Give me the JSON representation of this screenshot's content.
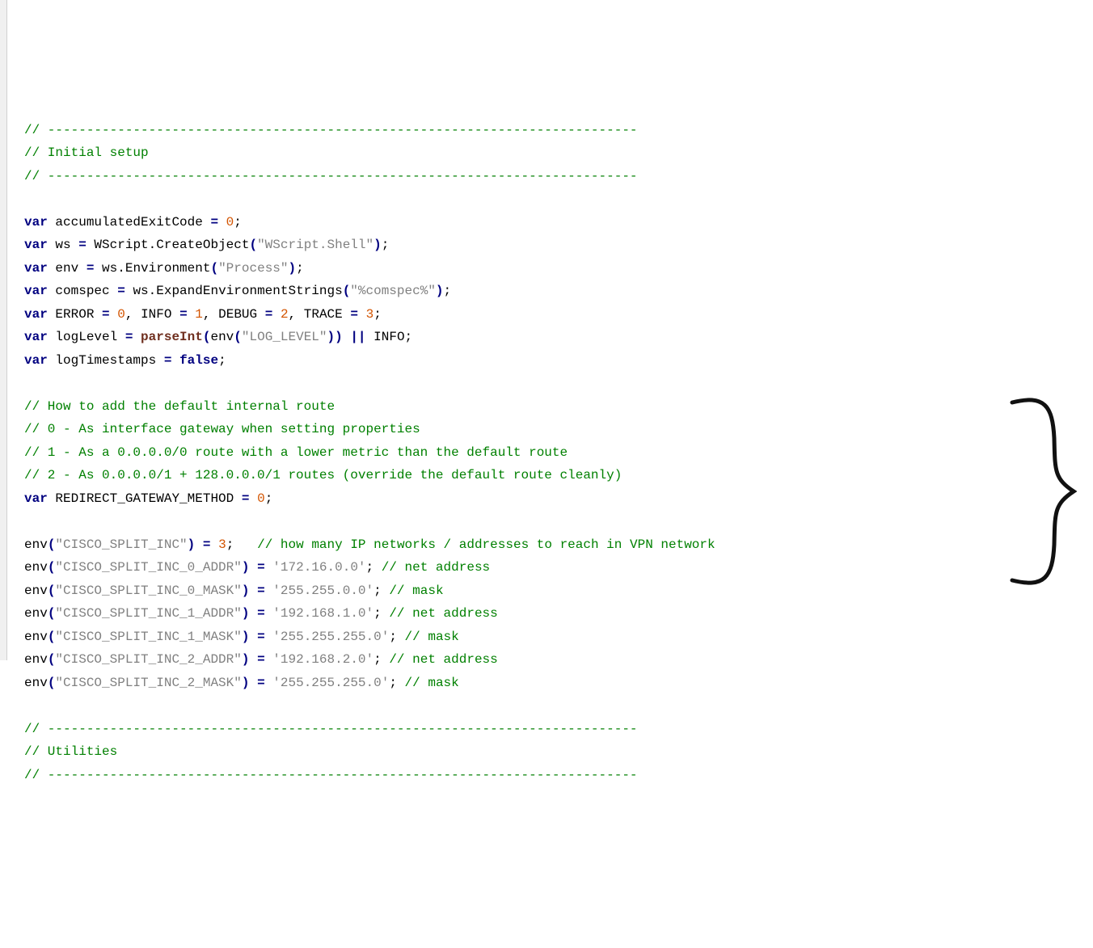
{
  "lines": [
    [
      [
        "c",
        "// ----------------------------------------------------------------------------"
      ]
    ],
    [
      [
        "c",
        "// Initial setup"
      ]
    ],
    [
      [
        "c",
        "// ----------------------------------------------------------------------------"
      ]
    ],
    [
      [
        "id",
        ""
      ]
    ],
    [
      [
        "kw",
        "var"
      ],
      [
        "id",
        " accumulatedExitCode "
      ],
      [
        "op",
        "="
      ],
      [
        "id",
        " "
      ],
      [
        "num",
        "0"
      ],
      [
        "id",
        ";"
      ]
    ],
    [
      [
        "kw",
        "var"
      ],
      [
        "id",
        " ws "
      ],
      [
        "op",
        "="
      ],
      [
        "id",
        " WScript.CreateObject"
      ],
      [
        "p",
        "("
      ],
      [
        "str",
        "\"WScript.Shell\""
      ],
      [
        "p",
        ")"
      ],
      [
        "id",
        ";"
      ]
    ],
    [
      [
        "kw",
        "var"
      ],
      [
        "id",
        " env "
      ],
      [
        "op",
        "="
      ],
      [
        "id",
        " ws.Environment"
      ],
      [
        "p",
        "("
      ],
      [
        "str",
        "\"Process\""
      ],
      [
        "p",
        ")"
      ],
      [
        "id",
        ";"
      ]
    ],
    [
      [
        "kw",
        "var"
      ],
      [
        "id",
        " comspec "
      ],
      [
        "op",
        "="
      ],
      [
        "id",
        " ws.ExpandEnvironmentStrings"
      ],
      [
        "p",
        "("
      ],
      [
        "str",
        "\"%comspec%\""
      ],
      [
        "p",
        ")"
      ],
      [
        "id",
        ";"
      ]
    ],
    [
      [
        "kw",
        "var"
      ],
      [
        "id",
        " ERROR "
      ],
      [
        "op",
        "="
      ],
      [
        "id",
        " "
      ],
      [
        "num",
        "0"
      ],
      [
        "id",
        ", INFO "
      ],
      [
        "op",
        "="
      ],
      [
        "id",
        " "
      ],
      [
        "num",
        "1"
      ],
      [
        "id",
        ", DEBUG "
      ],
      [
        "op",
        "="
      ],
      [
        "id",
        " "
      ],
      [
        "num",
        "2"
      ],
      [
        "id",
        ", TRACE "
      ],
      [
        "op",
        "="
      ],
      [
        "id",
        " "
      ],
      [
        "num",
        "3"
      ],
      [
        "id",
        ";"
      ]
    ],
    [
      [
        "kw",
        "var"
      ],
      [
        "id",
        " logLevel "
      ],
      [
        "op",
        "="
      ],
      [
        "id",
        " "
      ],
      [
        "fn",
        "parseInt"
      ],
      [
        "p",
        "("
      ],
      [
        "id",
        "env"
      ],
      [
        "p",
        "("
      ],
      [
        "str",
        "\"LOG_LEVEL\""
      ],
      [
        "p",
        "))"
      ],
      [
        "id",
        " "
      ],
      [
        "op",
        "||"
      ],
      [
        "id",
        " INFO;"
      ]
    ],
    [
      [
        "kw",
        "var"
      ],
      [
        "id",
        " logTimestamps "
      ],
      [
        "op",
        "="
      ],
      [
        "id",
        " "
      ],
      [
        "kw",
        "false"
      ],
      [
        "id",
        ";"
      ]
    ],
    [
      [
        "id",
        ""
      ]
    ],
    [
      [
        "c",
        "// How to add the default internal route"
      ]
    ],
    [
      [
        "c",
        "// 0 - As interface gateway when setting properties"
      ]
    ],
    [
      [
        "c",
        "// 1 - As a 0.0.0.0/0 route with a lower metric than the default route"
      ]
    ],
    [
      [
        "c",
        "// 2 - As 0.0.0.0/1 + 128.0.0.0/1 routes (override the default route cleanly)"
      ]
    ],
    [
      [
        "kw",
        "var"
      ],
      [
        "id",
        " REDIRECT_GATEWAY_METHOD "
      ],
      [
        "op",
        "="
      ],
      [
        "id",
        " "
      ],
      [
        "num",
        "0"
      ],
      [
        "id",
        ";"
      ]
    ],
    [
      [
        "id",
        ""
      ]
    ],
    [
      [
        "id",
        "env"
      ],
      [
        "p",
        "("
      ],
      [
        "str",
        "\"CISCO_SPLIT_INC\""
      ],
      [
        "p",
        ")"
      ],
      [
        "id",
        " "
      ],
      [
        "op",
        "="
      ],
      [
        "id",
        " "
      ],
      [
        "num",
        "3"
      ],
      [
        "id",
        ";   "
      ],
      [
        "c",
        "// how many IP networks / addresses to reach in VPN network"
      ]
    ],
    [
      [
        "id",
        "env"
      ],
      [
        "p",
        "("
      ],
      [
        "str",
        "\"CISCO_SPLIT_INC_0_ADDR\""
      ],
      [
        "p",
        ")"
      ],
      [
        "id",
        " "
      ],
      [
        "op",
        "="
      ],
      [
        "id",
        " "
      ],
      [
        "str",
        "'172.16.0.0'"
      ],
      [
        "id",
        "; "
      ],
      [
        "c",
        "// net address"
      ]
    ],
    [
      [
        "id",
        "env"
      ],
      [
        "p",
        "("
      ],
      [
        "str",
        "\"CISCO_SPLIT_INC_0_MASK\""
      ],
      [
        "p",
        ")"
      ],
      [
        "id",
        " "
      ],
      [
        "op",
        "="
      ],
      [
        "id",
        " "
      ],
      [
        "str",
        "'255.255.0.0'"
      ],
      [
        "id",
        "; "
      ],
      [
        "c",
        "// mask"
      ]
    ],
    [
      [
        "id",
        "env"
      ],
      [
        "p",
        "("
      ],
      [
        "str",
        "\"CISCO_SPLIT_INC_1_ADDR\""
      ],
      [
        "p",
        ")"
      ],
      [
        "id",
        " "
      ],
      [
        "op",
        "="
      ],
      [
        "id",
        " "
      ],
      [
        "str",
        "'192.168.1.0'"
      ],
      [
        "id",
        "; "
      ],
      [
        "c",
        "// net address"
      ]
    ],
    [
      [
        "id",
        "env"
      ],
      [
        "p",
        "("
      ],
      [
        "str",
        "\"CISCO_SPLIT_INC_1_MASK\""
      ],
      [
        "p",
        ")"
      ],
      [
        "id",
        " "
      ],
      [
        "op",
        "="
      ],
      [
        "id",
        " "
      ],
      [
        "str",
        "'255.255.255.0'"
      ],
      [
        "id",
        "; "
      ],
      [
        "c",
        "// mask"
      ]
    ],
    [
      [
        "id",
        "env"
      ],
      [
        "p",
        "("
      ],
      [
        "str",
        "\"CISCO_SPLIT_INC_2_ADDR\""
      ],
      [
        "p",
        ")"
      ],
      [
        "id",
        " "
      ],
      [
        "op",
        "="
      ],
      [
        "id",
        " "
      ],
      [
        "str",
        "'192.168.2.0'"
      ],
      [
        "id",
        "; "
      ],
      [
        "c",
        "// net address"
      ]
    ],
    [
      [
        "id",
        "env"
      ],
      [
        "p",
        "("
      ],
      [
        "str",
        "\"CISCO_SPLIT_INC_2_MASK\""
      ],
      [
        "p",
        ")"
      ],
      [
        "id",
        " "
      ],
      [
        "op",
        "="
      ],
      [
        "id",
        " "
      ],
      [
        "str",
        "'255.255.255.0'"
      ],
      [
        "id",
        "; "
      ],
      [
        "c",
        "// mask"
      ]
    ],
    [
      [
        "id",
        ""
      ]
    ],
    [
      [
        "c",
        "// ----------------------------------------------------------------------------"
      ]
    ],
    [
      [
        "c",
        "// Utilities"
      ]
    ],
    [
      [
        "c",
        "// ----------------------------------------------------------------------------"
      ]
    ]
  ]
}
